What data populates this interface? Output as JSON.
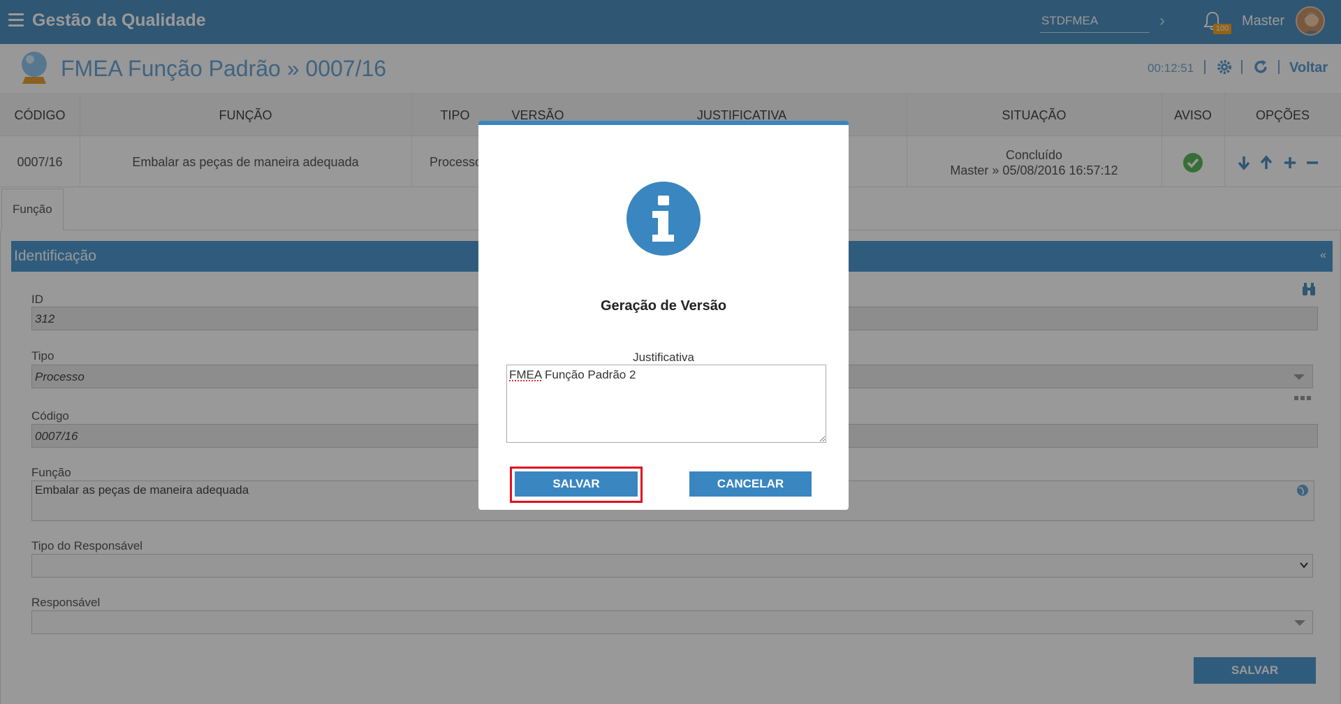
{
  "app": {
    "title": "Gestão da Qualidade",
    "search_value": "STDFMEA",
    "notification_count": "100",
    "user_name": "Master"
  },
  "page": {
    "title": "FMEA Função Padrão » 0007/16",
    "timer": "00:12:51",
    "back_label": "Voltar"
  },
  "table": {
    "headers": [
      "CÓDIGO",
      "FUNÇÃO",
      "TIPO",
      "VERSÃO",
      "JUSTIFICATIVA",
      "SITUAÇÃO",
      "AVISO",
      "OPÇÕES"
    ],
    "row": {
      "codigo": "0007/16",
      "funcao": "Embalar as peças de maneira adequada",
      "tipo": "Processo",
      "situacao": "Concluído",
      "situacao_detail": "Master » 05/08/2016 16:57:12"
    }
  },
  "tabs": [
    {
      "label": "Função"
    }
  ],
  "panel": {
    "title": "Identificação",
    "collapse_label": "«",
    "fields": {
      "id_label": "ID",
      "id_value": "312",
      "tipo_label": "Tipo",
      "tipo_value": "Processo",
      "codigo_label": "Código",
      "codigo_value": "0007/16",
      "funcao_label": "Função",
      "funcao_value": "Embalar as peças de maneira adequada",
      "tipo_resp_label": "Tipo do Responsável",
      "resp_label": "Responsável"
    },
    "save_label": "SALVAR"
  },
  "modal": {
    "title": "Geração de Versão",
    "field_label": "Justificativa",
    "field_value": "FMEA Função Padrão 2",
    "save_label": "SALVAR",
    "cancel_label": "CANCELAR"
  },
  "colors": {
    "primary": "#3a86c0",
    "highlight": "#e01020",
    "status_ok": "#5cb85c",
    "badge": "#f6a623"
  }
}
